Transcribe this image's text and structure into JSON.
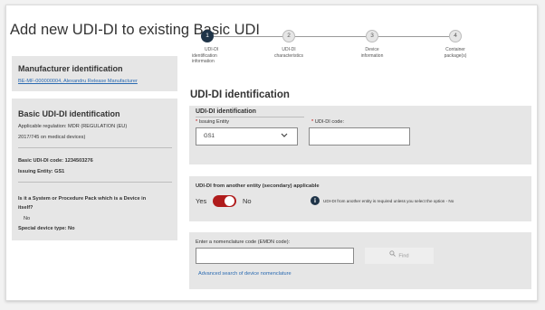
{
  "page": {
    "title": "Add new UDI-DI to existing Basic UDI"
  },
  "manufacturer": {
    "heading": "Manufacturer identification",
    "link": "BE-MF-000000004, Alexandru Release Manufacturer"
  },
  "basic_udi": {
    "heading": "Basic UDI-DI identification",
    "regulation_line1": "Applicable regulation: MDR (REGULATION (EU)",
    "regulation_line2": "2017/745 on medical devices)",
    "code": "Basic UDI-DI code: 1234503276",
    "issuing_entity": "Issuing Entity: GS1",
    "question_line1": "Is it a System or Procedure Pack which is a Device in",
    "question_line2": "itself?",
    "answer": "No",
    "special_type": "Special device type: No"
  },
  "stepper": {
    "steps": [
      {
        "num": "1",
        "line1": "UDI-DI",
        "line2": "identification",
        "line3": "information"
      },
      {
        "num": "2",
        "line1": "UDI-DI",
        "line2": "characteristics",
        "line3": ""
      },
      {
        "num": "3",
        "line1": "Device",
        "line2": "information",
        "line3": ""
      },
      {
        "num": "4",
        "line1": "Container",
        "line2": "package(s)",
        "line3": ""
      }
    ]
  },
  "udi_section": {
    "title": "UDI-DI identification",
    "panel_heading": "UDI-DI identification",
    "issuing_label": "Issuing Entity",
    "issuing_value": "GS1",
    "code_label": "UDI-DI code:",
    "code_value": ""
  },
  "secondary": {
    "heading": "UDI-DI from another entity (secondary) applicable",
    "yes": "Yes",
    "no": "No",
    "info": "UDI-DI from another entity is required unless you select the option - No",
    "toggle_state": "on"
  },
  "nomenclature": {
    "label": "Enter a nomenclature code (EMDN code):",
    "value": "",
    "find": "Find",
    "advanced": "Advanced search of device nomenclature"
  },
  "colors": {
    "primary": "#1f3448",
    "link": "#2a6ab1",
    "toggle": "#b01c1c",
    "required": "#c00000",
    "panel": "#e6e6e6"
  }
}
